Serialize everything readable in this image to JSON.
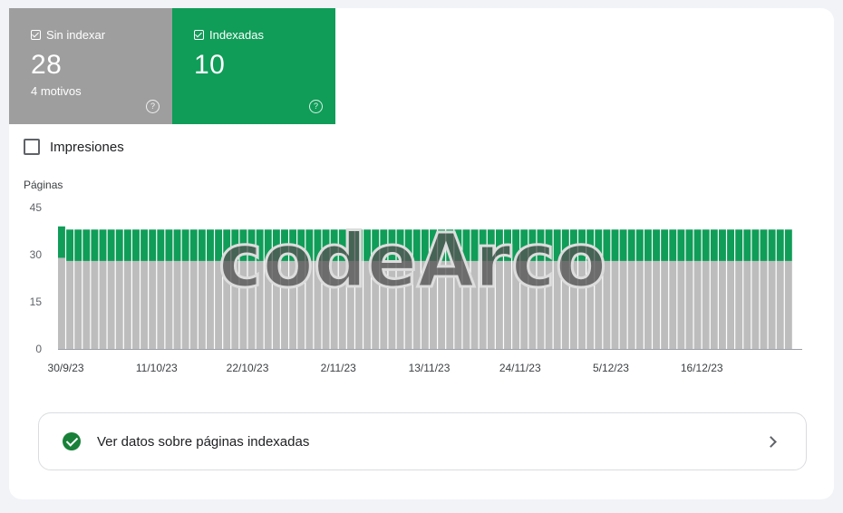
{
  "tiles": [
    {
      "label": "Sin indexar",
      "value": "28",
      "sub": "4 motivos",
      "color": "#9e9e9e"
    },
    {
      "label": "Indexadas",
      "value": "10",
      "sub": "",
      "color": "#0f9d58"
    }
  ],
  "impressions": {
    "label": "Impresiones",
    "checked": false
  },
  "watermark": "codeArco",
  "chart_data": {
    "type": "bar",
    "stacked": true,
    "ylabel": "Páginas",
    "ylim": [
      0,
      45
    ],
    "yticks": [
      "45",
      "30",
      "15",
      "0"
    ],
    "xticks": [
      "30/9/23",
      "11/10/23",
      "22/10/23",
      "2/11/23",
      "13/11/23",
      "24/11/23",
      "5/12/23",
      "16/12/23"
    ],
    "first_day": "30/9/23",
    "series": [
      {
        "name": "Sin indexar",
        "color": "#bdbdbd",
        "values": [
          29,
          28,
          28,
          28,
          28,
          28,
          28,
          28,
          28,
          28,
          28,
          28,
          28,
          28,
          28,
          28,
          28,
          28,
          28,
          28,
          28,
          28,
          28,
          28,
          28,
          28,
          28,
          28,
          28,
          28,
          28,
          28,
          28,
          28,
          28,
          28,
          28,
          28,
          28,
          28,
          28,
          28,
          28,
          28,
          28,
          28,
          28,
          28,
          28,
          28,
          28,
          28,
          28,
          28,
          28,
          28,
          28,
          28,
          28,
          28,
          28,
          28,
          28,
          28,
          28,
          28,
          28,
          28,
          28,
          28,
          28,
          28,
          28,
          28,
          28,
          28,
          28,
          28,
          28,
          28,
          28,
          28,
          28,
          28,
          28,
          28,
          28,
          28,
          28
        ]
      },
      {
        "name": "Indexadas",
        "color": "#0f9d58",
        "values": [
          10,
          10,
          10,
          10,
          10,
          10,
          10,
          10,
          10,
          10,
          10,
          10,
          10,
          10,
          10,
          10,
          10,
          10,
          10,
          10,
          10,
          10,
          10,
          10,
          10,
          10,
          10,
          10,
          10,
          10,
          10,
          10,
          10,
          10,
          10,
          10,
          10,
          10,
          10,
          10,
          10,
          10,
          10,
          10,
          10,
          10,
          10,
          10,
          10,
          10,
          10,
          10,
          10,
          10,
          10,
          10,
          10,
          10,
          10,
          10,
          10,
          10,
          10,
          10,
          10,
          10,
          10,
          10,
          10,
          10,
          10,
          10,
          10,
          10,
          10,
          10,
          10,
          10,
          10,
          10,
          10,
          10,
          10,
          10,
          10,
          10,
          10,
          10,
          10
        ]
      }
    ]
  },
  "link": {
    "label": "Ver datos sobre páginas indexadas"
  }
}
